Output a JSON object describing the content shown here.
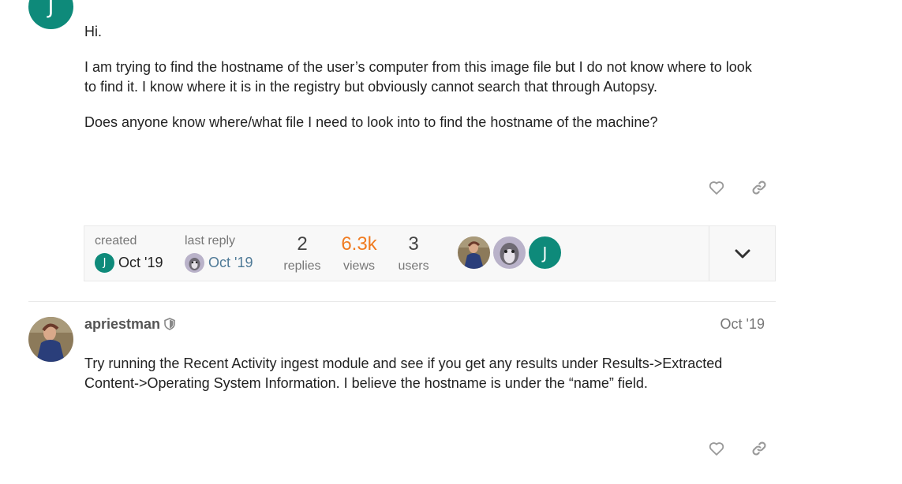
{
  "op": {
    "avatar_letter": "J",
    "paragraphs": [
      "Hi.",
      "I am trying to find the hostname of the user’s computer from this image file but I do not know where to look to find it. I know where it is in the registry but obviously cannot search that through Autopsy.",
      "Does anyone know where/what file I need to look into to find the hostname of the machine?"
    ]
  },
  "topic_map": {
    "created_label": "created",
    "created_avatar_letter": "J",
    "created_date": "Oct '19",
    "last_reply_label": "last reply",
    "last_reply_date": "Oct '19",
    "replies_count": "2",
    "replies_label": "replies",
    "views_count": "6.3k",
    "views_label": "views",
    "users_count": "3",
    "users_label": "users",
    "participant_letter": "J"
  },
  "reply": {
    "username": "apriestman",
    "date": "Oct '19",
    "body": "Try running the Recent Activity ingest module and see if you get any results under Results->Extracted Content->Operating System Information. I believe the hostname is under the “name” field."
  },
  "icons": {
    "like": "heart-icon",
    "share": "link-icon",
    "expand": "chevron-down-icon",
    "moderator": "shield-icon"
  },
  "colors": {
    "avatar_teal": "#0e8a7a",
    "link_blue": "#4f7a97",
    "hot_orange": "#f07b20"
  }
}
